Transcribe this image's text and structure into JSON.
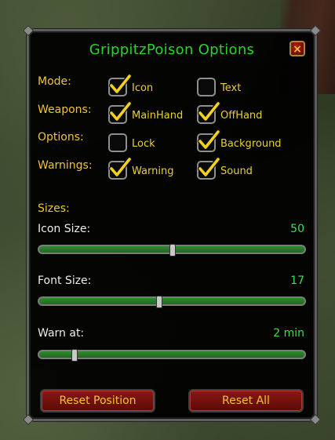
{
  "window": {
    "title": "GrippitzPoison Options",
    "close_label": "×"
  },
  "rows": {
    "mode": {
      "label": "Mode:",
      "opt1": {
        "label": "Icon",
        "checked": true
      },
      "opt2": {
        "label": "Text",
        "checked": false
      }
    },
    "weapons": {
      "label": "Weapons:",
      "opt1": {
        "label": "MainHand",
        "checked": true
      },
      "opt2": {
        "label": "OffHand",
        "checked": true
      }
    },
    "options": {
      "label": "Options:",
      "opt1": {
        "label": "Lock",
        "checked": false
      },
      "opt2": {
        "label": "Background",
        "checked": true
      }
    },
    "warnings": {
      "label": "Warnings:",
      "opt1": {
        "label": "Warning",
        "checked": true
      },
      "opt2": {
        "label": "Sound",
        "checked": true
      }
    }
  },
  "sizes_heading": "Sizes:",
  "sliders": {
    "icon_size": {
      "label": "Icon Size:",
      "value": "50",
      "fraction": 0.5
    },
    "font_size": {
      "label": "Font Size:",
      "value": "17",
      "fraction": 0.45
    },
    "warn_at": {
      "label": "Warn at:",
      "value": "2 min",
      "fraction": 0.13
    }
  },
  "buttons": {
    "reset_position": "Reset Position",
    "reset_all": "Reset All"
  },
  "colors": {
    "title": "#27d427",
    "gold": "#f2c431",
    "value_green": "#3fdf4f",
    "button_red": "#8a1812"
  }
}
